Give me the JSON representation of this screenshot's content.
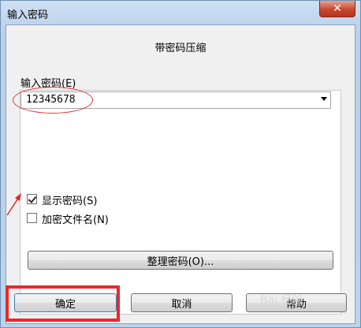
{
  "window": {
    "title": "输入密码",
    "close_glyph": "✕"
  },
  "heading": "带密码压缩",
  "password": {
    "label": "输入密码(E)",
    "value": "12345678"
  },
  "options": [
    {
      "label": "显示密码(S)",
      "checked": true
    },
    {
      "label": "加密文件名(N)",
      "checked": false
    }
  ],
  "organize_button": "整理密码(O)...",
  "buttons": {
    "ok": "确定",
    "cancel": "取消",
    "help": "帮助"
  },
  "watermark": "Bai 经验",
  "colors": {
    "annotation_red": "#e8282a",
    "title_bar": "#b9d1ea",
    "close_button": "#c9482f"
  }
}
